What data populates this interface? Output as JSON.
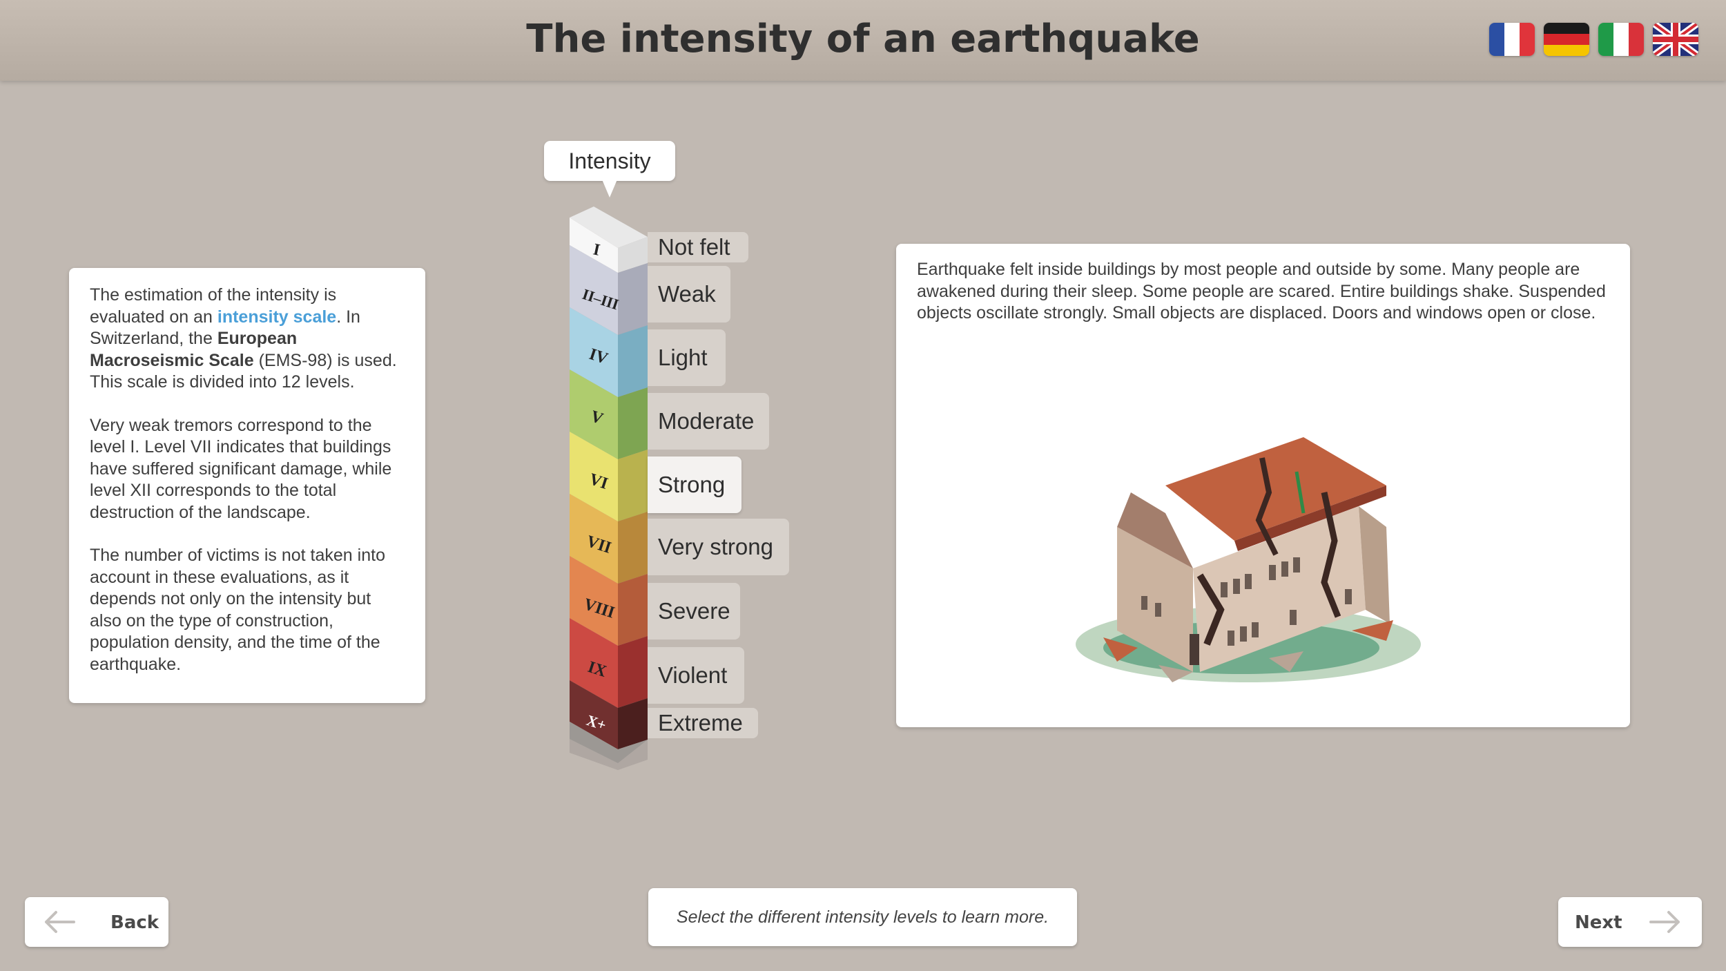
{
  "header": {
    "title": "The intensity of an earthquake",
    "flags": [
      "French",
      "German",
      "Italian",
      "English"
    ]
  },
  "left_panel": {
    "p1_a": "The estimation of the intensity is evaluated on an ",
    "p1_link": "intensity scale",
    "p1_b": ". In Switzerland, the ",
    "p1_bold": "European Macroseismic Scale",
    "p1_c": " (EMS-98) is used. This scale is divided into 12 levels.",
    "p2": "Very weak tremors correspond to the level I. Level VII indicates that buildings have suffered significant damage, while level XII corresponds to the total destruction of the landscape.",
    "p3": "The number of victims is not taken into account in these evaluations, as it depends not only on the intensity but also on the type of construction, population density, and the time of the earthquake."
  },
  "scale": {
    "label": "Intensity",
    "selected": "Strong",
    "levels": [
      {
        "numeral": "I",
        "name": "Not felt",
        "color": "#f0f0ef"
      },
      {
        "numeral": "II–III",
        "name": "Weak",
        "color": "#c9cbd9"
      },
      {
        "numeral": "IV",
        "name": "Light",
        "color": "#a6cfe0"
      },
      {
        "numeral": "V",
        "name": "Moderate",
        "color": "#a9c767"
      },
      {
        "numeral": "VI",
        "name": "Strong",
        "color": "#e4de6c"
      },
      {
        "numeral": "VII",
        "name": "Very strong",
        "color": "#e2b352"
      },
      {
        "numeral": "VIII",
        "name": "Severe",
        "color": "#e07f49"
      },
      {
        "numeral": "IX",
        "name": "Violent",
        "color": "#c9403b"
      },
      {
        "numeral": "X+",
        "name": "Extreme",
        "color": "#6b2a29"
      }
    ]
  },
  "detail": {
    "text": "Earthquake felt inside buildings by most people and outside by some. Many people are awakened during their sleep. Some people are scared. Entire buildings shake. Suspended objects oscillate strongly. Small objects are displaced. Doors and windows open or close."
  },
  "footer": {
    "prompt": "Select the different intensity levels to learn more.",
    "back": "Back",
    "next": "Next"
  }
}
